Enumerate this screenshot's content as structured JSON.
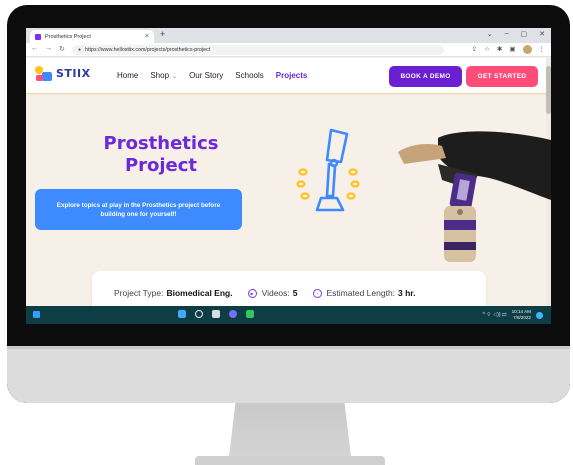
{
  "browser": {
    "tab_title": "Prosthetics Project",
    "tab_close": "×",
    "new_tab": "+",
    "window_controls": [
      "⌄",
      "–",
      "▢",
      "✕"
    ],
    "nav_icons": [
      "←",
      "→",
      "↻"
    ],
    "url": "https://www.hellostiix.com/projects/prosthetics-project",
    "tools": [
      "⇪",
      "☆",
      "✱",
      "▣",
      "⋮"
    ]
  },
  "site": {
    "logo_text": "STIIX",
    "nav": [
      {
        "label": "Home"
      },
      {
        "label": "Shop",
        "chevron": "⌄"
      },
      {
        "label": "Our Story"
      },
      {
        "label": "Schools"
      },
      {
        "label": "Projects",
        "active": true
      }
    ],
    "book_demo": "BOOK A DEMO",
    "get_started": "GET STARTED",
    "colors": {
      "purple": "#6a1fd1",
      "pink": "#ff4d79",
      "blue": "#3d8bff",
      "yellow": "#ffc21b",
      "background": "#f6f0e9",
      "taskbar": "#0e3d44"
    }
  },
  "hero": {
    "title_line1": "Prosthetics",
    "title_line2": "Project",
    "cta": "Explore topics at play in the Prosthetics project before building one for yourself!"
  },
  "info": {
    "type_label": "Project Type:",
    "type_value": "Biomedical Eng.",
    "videos_label": "Videos:",
    "videos_value": "5",
    "length_label": "Estimated Length:",
    "length_value": "3 hr.",
    "video_icon": "▶",
    "clock_icon": "◔"
  },
  "taskbar": {
    "tray_icons": "^ ⌔ ◁)) ⇄",
    "time": "10:14 AM",
    "date": "7/8/2022"
  }
}
